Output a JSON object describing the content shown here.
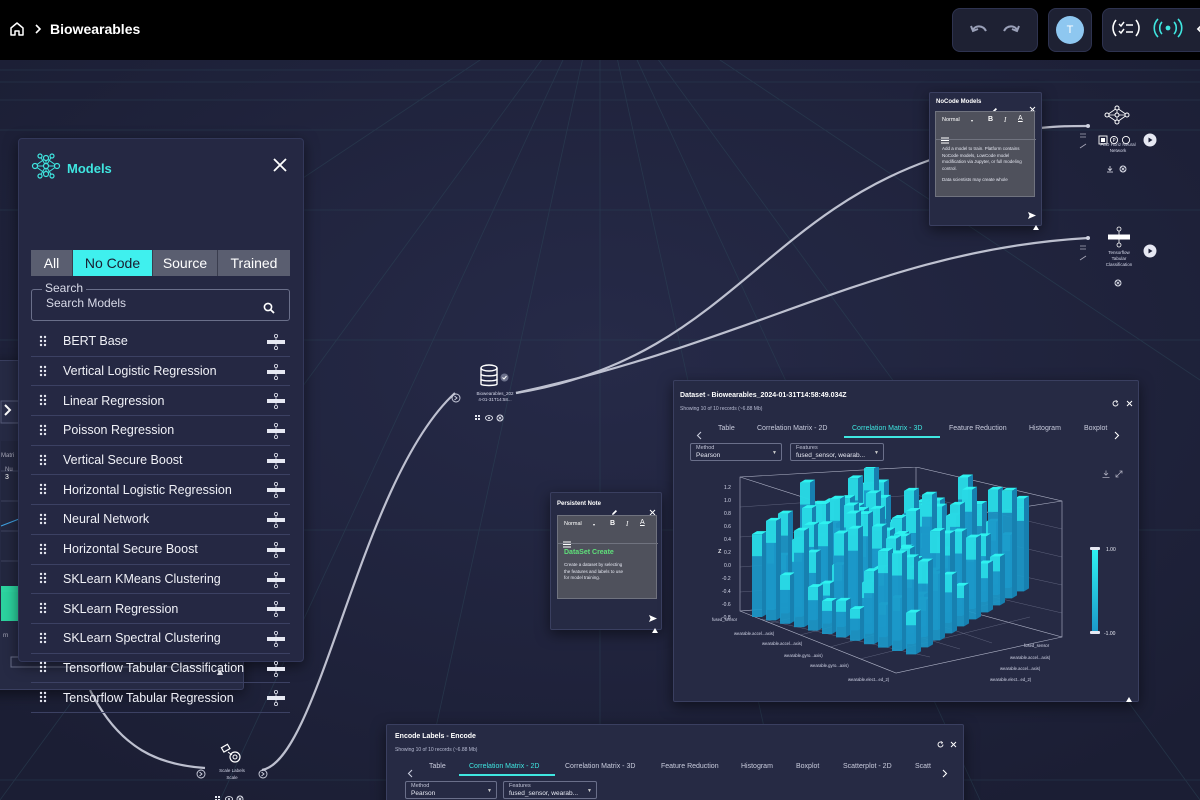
{
  "topbar": {
    "title": "Biowearables"
  },
  "user": {
    "initial": "T"
  },
  "models_panel": {
    "title": "Models",
    "filters": [
      "All",
      "No Code",
      "Source",
      "Trained"
    ],
    "active_filter": "No Code",
    "search_label": "Search",
    "search_placeholder": "Search Models",
    "items": [
      "BERT Base",
      "Vertical Logistic Regression",
      "Linear Regression",
      "Poisson Regression",
      "Vertical Secure Boost",
      "Horizontal Logistic Regression",
      "Neural Network",
      "Horizontal Secure Boost",
      "SKLearn KMeans Clustering",
      "SKLearn Regression",
      "SKLearn Spectral Clustering",
      "Tensorflow Tabular Classification",
      "Tensorflow Tabular Regression"
    ]
  },
  "dataset_node": {
    "label_l1": "Biowearables_202",
    "label_l2": "4-01-31T14:58..."
  },
  "scale_node": {
    "label_l1": "Scale Labels",
    "label_l2": "Scale"
  },
  "fed_node": {
    "label_l1": "FED Horiz Neural",
    "label_l2": "Network"
  },
  "tf_node": {
    "label_l1": "Tensorflow",
    "label_l2": "Tabular",
    "label_l3": "Classification"
  },
  "nocode_note": {
    "title": "NoCode Models",
    "format": "Normal",
    "text_l1": "Add a model to train. Platform contains",
    "text_l2": "NoCode models, LowCode model",
    "text_l3": "modification via Jupyter, or full modeling",
    "text_l4": "control.",
    "text_l5": "Data scientists may create whole"
  },
  "persistent_note": {
    "title": "Persistent Note",
    "format": "Normal",
    "heading": "DataSet Create",
    "text_l1": "Create a dataset by selecting",
    "text_l2": "the features and labels to use",
    "text_l3": "for model training."
  },
  "dataset_panel": {
    "title": "Dataset - Biowearables_2024-01-31T14:58:49.034Z",
    "subtitle": "Showing 10 of 10 records (~6.88 Mb)",
    "tabs": [
      "Table",
      "Correlation Matrix - 2D",
      "Correlation Matrix - 3D",
      "Feature Reduction",
      "Histogram",
      "Boxplot"
    ],
    "active_tab": "Correlation Matrix - 3D",
    "method_label": "Method",
    "method_value": "Pearson",
    "features_label": "Features",
    "features_value": "fused_sensor, wearab...",
    "z_label": "z",
    "z_ticks": [
      "1.2",
      "1.0",
      "0.8",
      "0.6",
      "0.4",
      "0.2",
      "0.0",
      "-0.2",
      "-0.4",
      "-0.6",
      "-0.8"
    ],
    "x_ticks": [
      "fused_sensor",
      "wearable.accel...axis)",
      "wearable.accel...axis)",
      "wearable.gyro...axis)",
      "wearable.gyro...axis)",
      "wearable.elect...ed_2)"
    ],
    "y_ticks": [
      "fused_sensor",
      "wearable.accel...axis)",
      "wearable.accel...axis)",
      "wearable.elect...ed_2)"
    ],
    "colorbar_max": "1.00",
    "colorbar_min": "-1.00"
  },
  "encode_panel": {
    "title": "Encode Labels - Encode",
    "subtitle": "Showing 10 of 10 records (~6.88 Mb)",
    "tabs": [
      "Table",
      "Correlation Matrix - 2D",
      "Correlation Matrix - 3D",
      "Feature Reduction",
      "Histogram",
      "Boxplot",
      "Scatterplot - 2D",
      "Scatt"
    ],
    "active_tab": "Correlation Matrix - 2D",
    "method_label": "Method",
    "method_value": "Pearson",
    "features_label": "Features",
    "features_value": "fused_sensor, wearab..."
  },
  "left_partial": {
    "label_a": "Matri",
    "label_b": "Nu",
    "label_c": "3",
    "label_d": "rn"
  },
  "colors": {
    "accent": "#3fe6e0",
    "background": "#1d2038",
    "panel": "#252843",
    "bar_top": "#2ef2f0",
    "bar_side": "#1b98c9"
  }
}
